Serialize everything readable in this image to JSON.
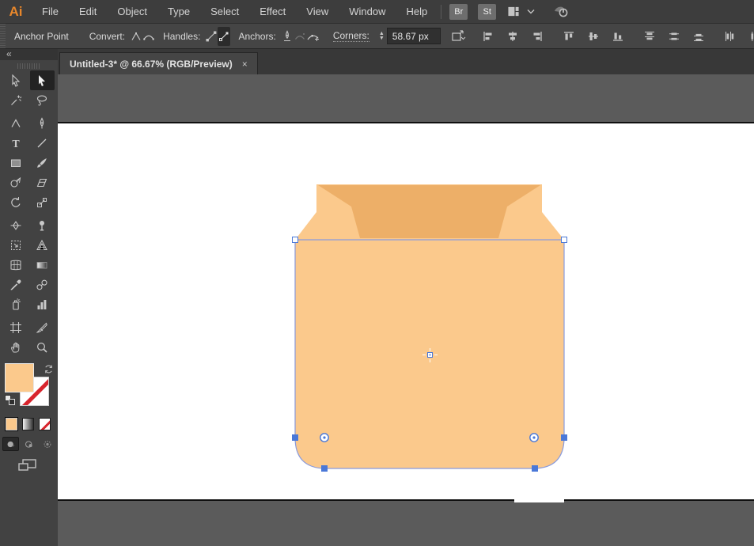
{
  "app": {
    "logo": "Ai"
  },
  "menubar": {
    "items": [
      "File",
      "Edit",
      "Object",
      "Type",
      "Select",
      "Effect",
      "View",
      "Window",
      "Help"
    ],
    "bridge_label": "Br",
    "stock_label": "St"
  },
  "control_bar": {
    "panel_label": "Anchor Point",
    "convert_label": "Convert:",
    "handles_label": "Handles:",
    "anchors_label": "Anchors:",
    "corners_label": "Corners:",
    "corners_value": "58.67 px",
    "align_buttons": [
      "align-left",
      "align-horizontal-center",
      "align-right",
      "align-top",
      "align-vertical-center",
      "align-bottom",
      "distribute-top",
      "distribute-vertical-center",
      "distribute-bottom",
      "distribute-left",
      "distribute-horizontal-center",
      "distribute-right"
    ]
  },
  "document_tab": {
    "title": "Untitled-3* @ 66.67% (RGB/Preview)",
    "close_glyph": "×"
  },
  "toolbar": {
    "collapse_glyph": "«",
    "tools": [
      {
        "name": "direct-selection-tool",
        "active": false
      },
      {
        "name": "selection-tool",
        "active": true
      },
      {
        "name": "magic-wand-tool",
        "active": false
      },
      {
        "name": "lasso-tool",
        "active": false
      },
      {
        "name": "anchor-point-tool",
        "active": false
      },
      {
        "name": "pen-tool",
        "active": false
      },
      {
        "name": "type-tool",
        "active": false
      },
      {
        "name": "line-segment-tool",
        "active": false
      },
      {
        "name": "rectangle-tool",
        "active": false
      },
      {
        "name": "paintbrush-tool",
        "active": false
      },
      {
        "name": "shape-builder-tool",
        "active": false
      },
      {
        "name": "eraser-tool",
        "active": false
      },
      {
        "name": "rotate-tool",
        "active": false
      },
      {
        "name": "scale-tool",
        "active": false
      },
      {
        "name": "width-tool",
        "active": false
      },
      {
        "name": "puppet-warp-tool",
        "active": false
      },
      {
        "name": "free-transform-tool",
        "active": false
      },
      {
        "name": "perspective-grid-tool",
        "active": false
      },
      {
        "name": "mesh-tool",
        "active": false
      },
      {
        "name": "gradient-tool",
        "active": false
      },
      {
        "name": "eyedropper-tool",
        "active": false
      },
      {
        "name": "blend-tool",
        "active": false
      },
      {
        "name": "symbol-sprayer-tool",
        "active": false
      },
      {
        "name": "column-graph-tool",
        "active": false
      },
      {
        "name": "artboard-tool",
        "active": false
      },
      {
        "name": "slice-tool",
        "active": false
      },
      {
        "name": "hand-tool",
        "active": false
      },
      {
        "name": "zoom-tool",
        "active": false
      }
    ],
    "group_breaks": [
      1,
      6,
      11
    ]
  },
  "colors": {
    "fill_color": "#FBC98C",
    "shape_light": "#FBC98C",
    "shape_dark": "#EDAF68",
    "selection_blue": "#4A78D8",
    "logo_orange": "#E8872B",
    "none_red": "#D8242C"
  }
}
